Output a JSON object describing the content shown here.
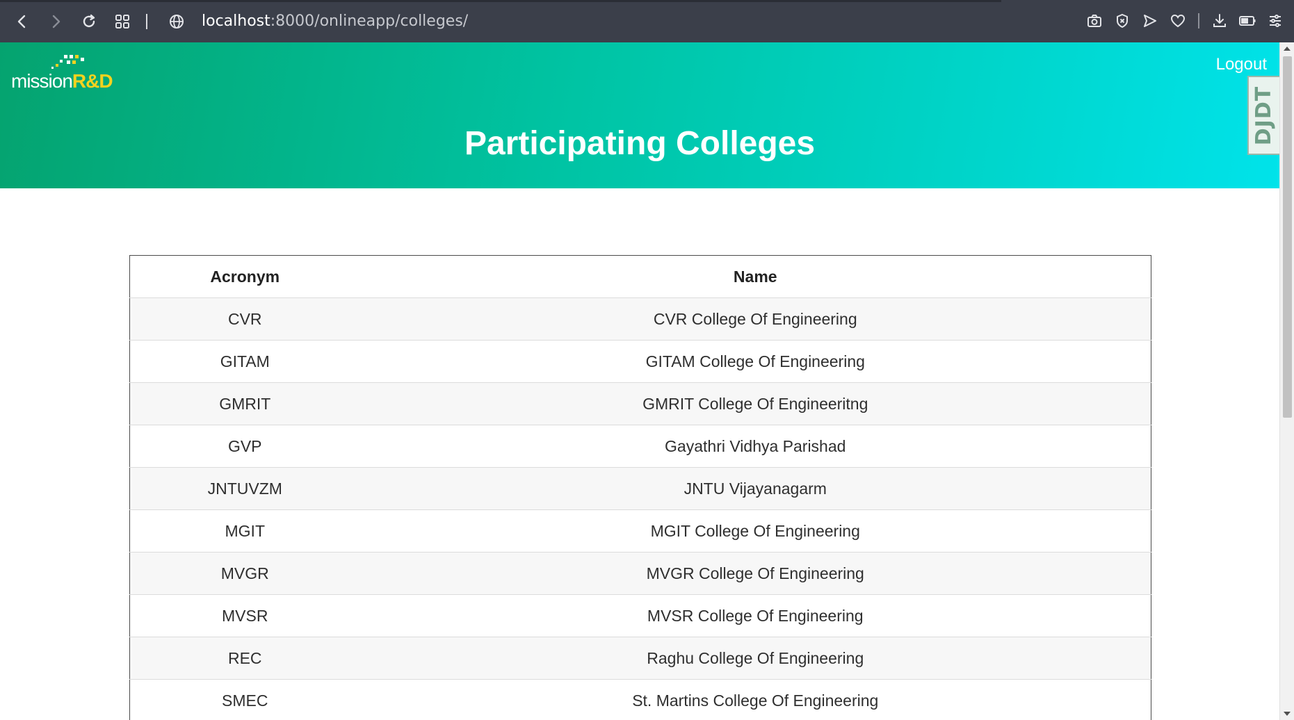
{
  "browser": {
    "url_host": "localhost",
    "url_rest": ":8000/onlineapp/colleges/"
  },
  "header": {
    "logo_text_main": "mission",
    "logo_text_accent": "R&D",
    "logout_label": "Logout",
    "title": "Participating Colleges",
    "debug_toolbar_label": "DJDT"
  },
  "table": {
    "headers": [
      "Acronym",
      "Name"
    ],
    "rows": [
      {
        "acronym": "CVR",
        "name": "CVR College Of Engineering"
      },
      {
        "acronym": "GITAM",
        "name": "GITAM College Of Engineering"
      },
      {
        "acronym": "GMRIT",
        "name": "GMRIT College Of Engineeritng"
      },
      {
        "acronym": "GVP",
        "name": "Gayathri Vidhya Parishad"
      },
      {
        "acronym": "JNTUVZM",
        "name": "JNTU Vijayanagarm"
      },
      {
        "acronym": "MGIT",
        "name": "MGIT College Of Engineering"
      },
      {
        "acronym": "MVGR",
        "name": "MVGR College Of Engineering"
      },
      {
        "acronym": "MVSR",
        "name": "MVSR College Of Engineering"
      },
      {
        "acronym": "REC",
        "name": "Raghu College Of Engineering"
      },
      {
        "acronym": "SMEC",
        "name": "St. Martins College Of Engineering"
      }
    ]
  },
  "colors": {
    "chrome_bg": "#3b3f4a",
    "hero_start": "#05a36f",
    "hero_end": "#00e3ea",
    "logo_accent": "#f5d21f"
  },
  "icons": {
    "back": "back-arrow-icon",
    "forward": "forward-arrow-icon",
    "reload": "reload-icon",
    "tabs": "tab-grid-icon",
    "site": "globe-icon",
    "camera": "camera-icon",
    "shield": "shield-icon",
    "send": "send-icon",
    "heart": "heart-icon",
    "download": "download-icon",
    "battery": "battery-icon",
    "menu": "menu-icon"
  }
}
